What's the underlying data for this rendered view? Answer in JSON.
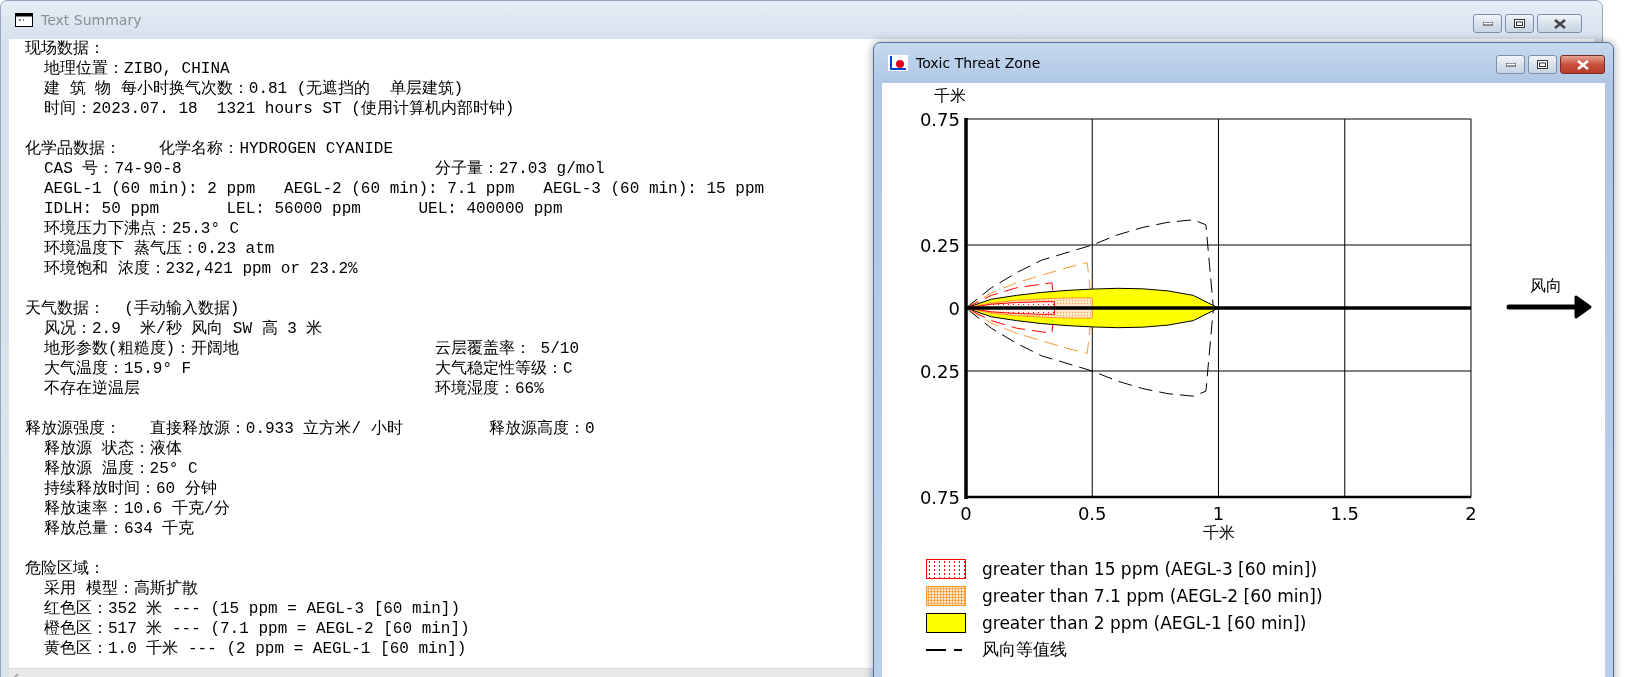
{
  "summary_window": {
    "title": "Text Summary",
    "active": false,
    "sections": [
      {
        "heading": "现场数据：",
        "lines": [
          {
            "text": "地理位置：ZIBO, CHINA"
          },
          {
            "text": "建 筑 物 每小时换气次数：0.81 (无遮挡的  单层建筑)"
          },
          {
            "text": "时间：2023.07. 18  1321 hours ST (使用计算机内部时钟)"
          }
        ]
      },
      {
        "heading": "化学品数据：    化学名称：HYDROGEN CYANIDE",
        "lines": [
          {
            "text": "CAS 号：74-90-8",
            "right": "分子量：27.03 g/mol"
          },
          {
            "text": "AEGL-1 (60 min): 2 ppm   AEGL-2 (60 min): 7.1 ppm   AEGL-3 (60 min): 15 ppm"
          },
          {
            "text": "IDLH: 50 ppm       LEL: 56000 ppm      UEL: 400000 ppm"
          },
          {
            "text": "环境压力下沸点：25.3° C"
          },
          {
            "text": "环境温度下 蒸气压：0.23 atm"
          },
          {
            "text": "环境饱和 浓度：232,421 ppm or 23.2%"
          }
        ]
      },
      {
        "heading": "天气数据：  (手动输入数据)",
        "lines": [
          {
            "text": "风况：2.9  米/秒 风向 SW 高 3 米"
          },
          {
            "text": "地形参数(粗糙度)：开阔地",
            "right": "云层覆盖率： 5/10"
          },
          {
            "text": "大气温度：15.9° F",
            "right": "大气稳定性等级：C"
          },
          {
            "text": "不存在逆温层",
            "right": "环境湿度：66%"
          }
        ]
      },
      {
        "heading": "释放源强度：   直接释放源：0.933 立方米/ 小时         释放源高度：0",
        "lines": [
          {
            "text": "释放源 状态：液体"
          },
          {
            "text": "释放源 温度：25° C"
          },
          {
            "text": "持续释放时间：60 分钟"
          },
          {
            "text": "释放速率：10.6 千克/分"
          },
          {
            "text": "释放总量：634 千克"
          }
        ]
      },
      {
        "heading": "危险区域：",
        "lines": [
          {
            "text": "采用 模型：高斯扩散"
          },
          {
            "text": "红色区：352 米 --- (15 ppm = AEGL-3 [60 min])"
          },
          {
            "text": "橙色区：517 米 --- (7.1 ppm = AEGL-2 [60 min])"
          },
          {
            "text": "黄色区：1.0 千米 --- (2 ppm = AEGL-1 [60 min])"
          }
        ]
      }
    ]
  },
  "threat_window": {
    "title": "Toxic Threat Zone",
    "active": true,
    "chart_data": {
      "type": "area",
      "xlabel": "千米",
      "ylabel": "千米",
      "xlim": [
        0,
        2
      ],
      "ylim": [
        -0.75,
        0.75
      ],
      "grid": true,
      "xticks": [
        0,
        0.5,
        1,
        1.5,
        2
      ],
      "yticks": [
        {
          "value": 0.75,
          "label": "0.75"
        },
        {
          "value": 0.25,
          "label": "0.25"
        },
        0,
        {
          "value": -0.25,
          "label": "0.25"
        },
        {
          "value": -0.75,
          "label": "0.75"
        }
      ]
    },
    "wind_label": "风向",
    "legend": [
      {
        "kind": "dotted",
        "color": "#ff0000",
        "label": "greater than 15 ppm (AEGL-3 [60 min])"
      },
      {
        "kind": "stippled",
        "color": "#ff9933",
        "label": "greater than 7.1 ppm (AEGL-2 [60 min])"
      },
      {
        "kind": "solid",
        "color": "#ffff00",
        "label": "greater than 2 ppm (AEGL-1 [60 min])"
      },
      {
        "kind": "dashed",
        "color": "#000000",
        "label": "风向等值线"
      }
    ]
  }
}
